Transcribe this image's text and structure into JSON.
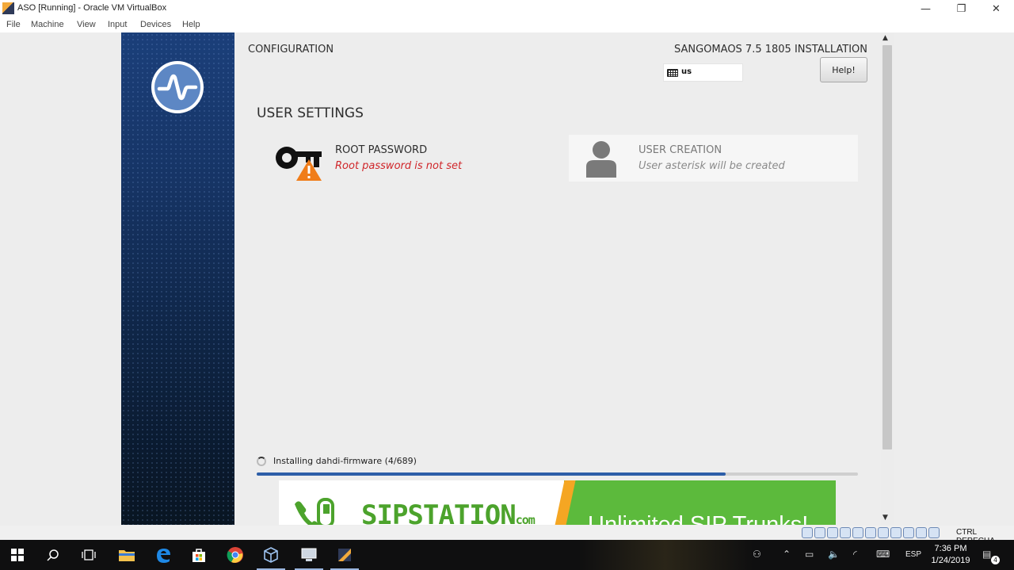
{
  "window": {
    "title": "ASO [Running] - Oracle VM VirtualBox",
    "minimize_glyph": "—",
    "restore_glyph": "❐",
    "close_glyph": "✕"
  },
  "menu": [
    "File",
    "Machine",
    "View",
    "Input",
    "Devices",
    "Help"
  ],
  "installer": {
    "config_title": "CONFIGURATION",
    "product_title": "SANGOMAOS 7.5 1805 INSTALLATION",
    "keyboard_layout": "us",
    "help_label": "Help!",
    "section_title": "USER SETTINGS",
    "root_password": {
      "title": "ROOT PASSWORD",
      "status": "Root password is not set",
      "status_color": "#d0262a"
    },
    "user_creation": {
      "title": "USER CREATION",
      "status": "User asterisk will be created"
    },
    "progress": {
      "text": "Installing dahdi-firmware (4/689)",
      "fraction": 0.78
    },
    "banner": {
      "brand": "SIPSTATION",
      "brand_suffix": "com",
      "slogan": "Unlimited SIP Trunks!"
    }
  },
  "vbox_status": {
    "host_key": "CTRL DERECHA"
  },
  "taskbar": {
    "language": "ESP",
    "time": "7:36 PM",
    "date": "1/24/2019",
    "notifications": "4"
  },
  "colors": {
    "sidebar": "#163465",
    "progress": "#2d5ea8",
    "banner_green": "#5cba3c",
    "banner_orange": "#f5a623"
  }
}
